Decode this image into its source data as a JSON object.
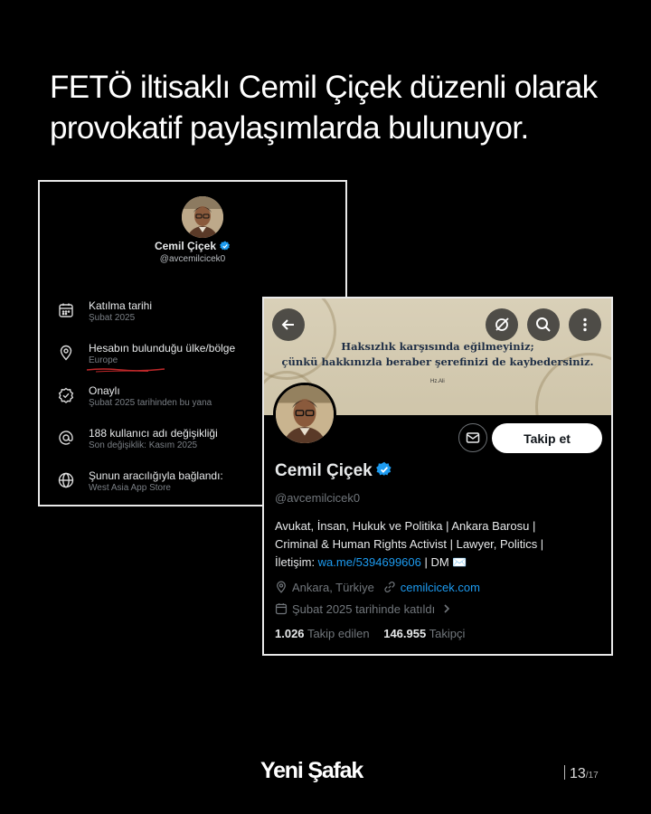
{
  "headline": {
    "line1": "FETÖ iltisaklı Cemil Çiçek düzenli olarak",
    "line2": "provokatif paylaşımlarda bulunuyor."
  },
  "about_card": {
    "name": "Cemil Çiçek",
    "handle": "@avcemilcicek0",
    "rows": [
      {
        "icon": "calendar-icon",
        "label": "Katılma tarihi",
        "value": "Şubat 2025"
      },
      {
        "icon": "location-pin-icon",
        "label": "Hesabın bulunduğu ülke/bölge",
        "value": "Europe"
      },
      {
        "icon": "verified-check-icon",
        "label": "Onaylı",
        "value": "Şubat 2025 tarihinden bu yana"
      },
      {
        "icon": "at-sign-icon",
        "label": "188 kullanıcı adı değişikliği",
        "value": "Son değişiklik: Kasım 2025"
      },
      {
        "icon": "globe-icon",
        "label": "Şunun aracılığıyla bağlandı:",
        "value": "West Asia App Store"
      }
    ]
  },
  "profile_card": {
    "banner": {
      "line1": "Haksızlık karşısında eğilmeyiniz;",
      "line2": "çünkü hakkınızla beraber şerefinizi de kaybedersiniz.",
      "signature": "Hz.Ali"
    },
    "follow_label": "Takip et",
    "name": "Cemil Çiçek",
    "handle": "@avcemilcicek0",
    "bio_line1": "Avukat, İnsan, Hukuk ve Politika | Ankara Barosu |",
    "bio_line2": "Criminal & Human Rights Activist | Lawyer, Politics |",
    "bio_contact_prefix": "İletişim: ",
    "bio_contact_link": "wa.me/5394699606",
    "bio_contact_suffix": " | DM ✉️",
    "location": "Ankara, Türkiye",
    "website": "cemilcicek.com",
    "joined": "Şubat 2025 tarihinde katıldı",
    "following_count": "1.026",
    "following_label": "Takip edilen",
    "followers_count": "146.955",
    "followers_label": "Takipçi"
  },
  "brand": "Yeni Şafak",
  "pager": {
    "current": "13",
    "total": "/17"
  },
  "colors": {
    "background": "#000000",
    "link": "#1d9bf0",
    "verified": "#1d9bf0",
    "card_border": "#e9e9e9"
  }
}
